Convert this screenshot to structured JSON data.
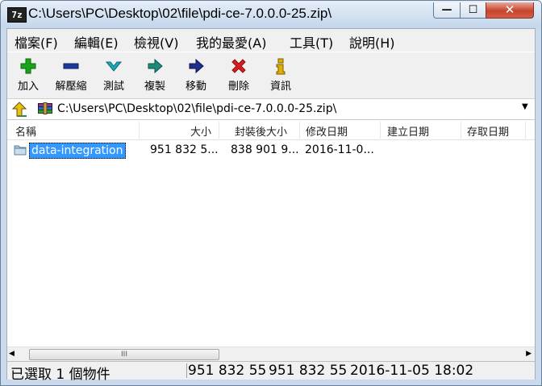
{
  "window": {
    "app_icon_text": "7z",
    "title": "C:\\Users\\PC\\Desktop\\02\\file\\pdi-ce-7.0.0.0-25.zip\\",
    "controls": {
      "minimize": "—",
      "maximize": "☐",
      "close": "✕"
    }
  },
  "menu": [
    "檔案(F)",
    "編輯(E)",
    "檢視(V)",
    "我的最愛(A)",
    "工具(T)",
    "說明(H)"
  ],
  "toolbar": [
    {
      "label": "加入",
      "icon": "plus-icon",
      "color": "#1aa31a"
    },
    {
      "label": "解壓縮",
      "icon": "minus-icon",
      "color": "#1e3a9c"
    },
    {
      "label": "測試",
      "icon": "check-icon",
      "color": "#1aa7b8"
    },
    {
      "label": "複製",
      "icon": "copy-arrow-icon",
      "color": "#1e8a7a"
    },
    {
      "label": "移動",
      "icon": "move-arrow-icon",
      "color": "#1e2f8c"
    },
    {
      "label": "刪除",
      "icon": "delete-x-icon",
      "color": "#d42020"
    },
    {
      "label": "資訊",
      "icon": "info-icon",
      "color": "#d8a800"
    }
  ],
  "address": {
    "path": "C:\\Users\\PC\\Desktop\\02\\file\\pdi-ce-7.0.0.0-25.zip\\"
  },
  "list": {
    "columns": [
      "名稱",
      "大小",
      "封裝後大小",
      "修改日期",
      "建立日期",
      "存取日期"
    ],
    "rows": [
      {
        "name": "data-integration",
        "size": "951 832 5...",
        "packed": "838 901 9...",
        "modified": "2016-11-0...",
        "created": "",
        "accessed": ""
      }
    ]
  },
  "scrollbar": {
    "left_arrow": "◀",
    "right_arrow": "▶",
    "grip": "III"
  },
  "status": {
    "selection": "已選取 1 個物件",
    "size": "951 832 55",
    "packed": "951 832 55",
    "date": "2016-11-05 18:02"
  }
}
